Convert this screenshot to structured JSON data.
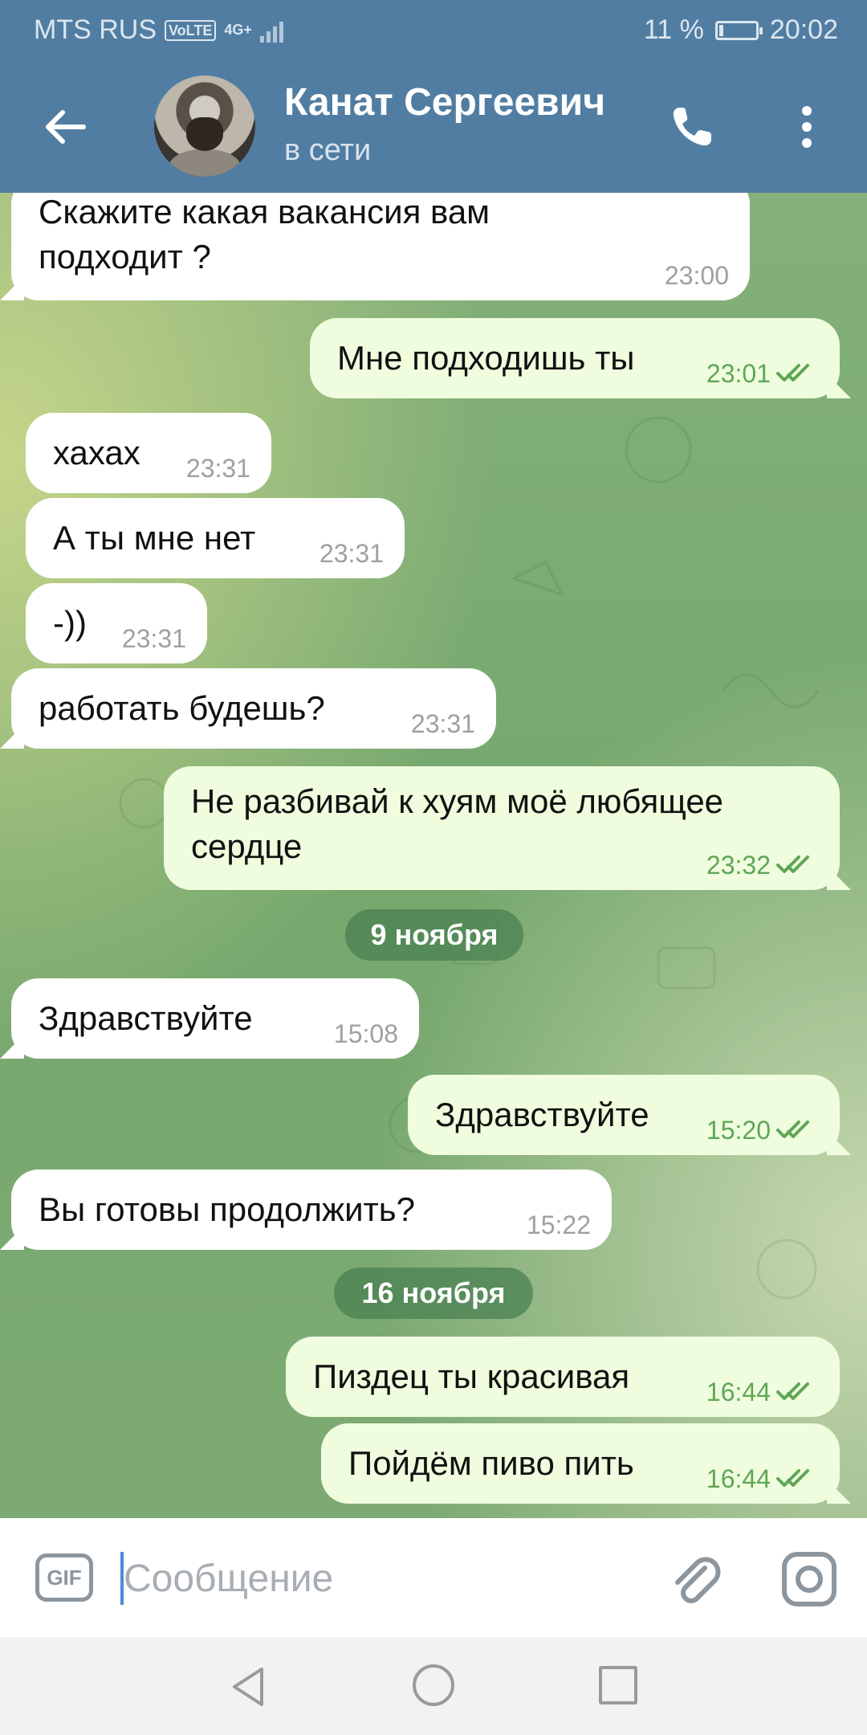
{
  "status_bar": {
    "carrier": "MTS RUS",
    "volte": "VoLTE",
    "network": "4G+",
    "battery": "11 %",
    "battery_level": 0.11,
    "time": "20:02"
  },
  "header": {
    "name": "Канат Сергеевич",
    "status": "в сети"
  },
  "messages": [
    {
      "dir": "in",
      "text": "Скажите какая вакансия вам\nподходит ?",
      "time": "23:00"
    },
    {
      "dir": "out",
      "text": "Мне подходишь ты",
      "time": "23:01",
      "read": true
    },
    {
      "dir": "in",
      "text": "хахах",
      "time": "23:31"
    },
    {
      "dir": "in",
      "text": "А ты мне нет",
      "time": "23:31"
    },
    {
      "dir": "in",
      "text": "-))",
      "time": "23:31"
    },
    {
      "dir": "in",
      "text": "работать будешь?",
      "time": "23:31"
    },
    {
      "dir": "out",
      "text": "Не разбивай к хуям моё любящее\nсердце",
      "time": "23:32",
      "read": true
    },
    {
      "dir": "date",
      "text": "9 ноября"
    },
    {
      "dir": "in",
      "text": "Здравствуйте",
      "time": "15:08"
    },
    {
      "dir": "out",
      "text": "Здравствуйте",
      "time": "15:20",
      "read": true
    },
    {
      "dir": "in",
      "text": "Вы готовы продолжить?",
      "time": "15:22"
    },
    {
      "dir": "date",
      "text": "16 ноября"
    },
    {
      "dir": "out",
      "text": "Пиздец ты красивая",
      "time": "16:44",
      "read": true
    },
    {
      "dir": "out",
      "text": "Пойдём пиво пить",
      "time": "16:44",
      "read": true
    }
  ],
  "composer": {
    "gif_label": "GIF",
    "placeholder": "Сообщение"
  },
  "icons": {
    "back": "back-arrow-icon",
    "call": "phone-icon",
    "more": "more-vertical-icon",
    "attach": "paperclip-icon",
    "camera": "camera-icon",
    "read": "double-check-icon"
  },
  "colors": {
    "header": "#517da2",
    "incoming_bubble": "#ffffff",
    "outgoing_bubble": "#effdde",
    "outgoing_time": "#5fa656",
    "date_pill": "#4a8052"
  }
}
